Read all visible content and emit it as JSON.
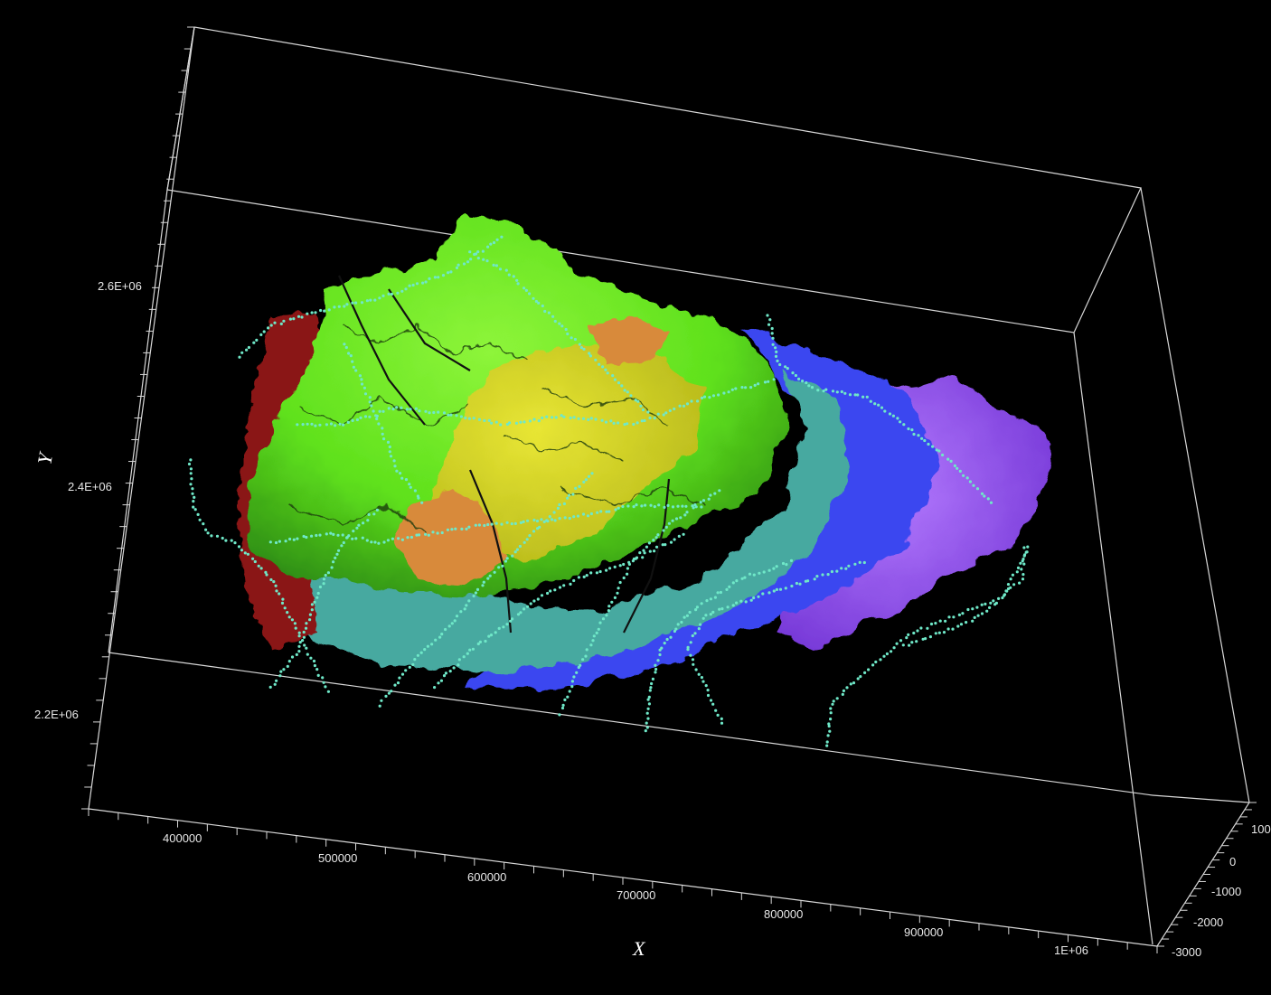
{
  "viewer": {
    "background": "#000000",
    "box_color": "#d8d8d8",
    "axes": {
      "x": {
        "title": "X",
        "ticks": [
          "400000",
          "500000",
          "600000",
          "700000",
          "800000",
          "900000",
          "1E+06"
        ]
      },
      "y": {
        "title": "Y",
        "ticks": [
          "2.2E+06",
          "2.4E+06",
          "2.6E+06"
        ]
      },
      "z": {
        "title": "",
        "ticks": [
          "100",
          "0",
          "-1000",
          "-2000",
          "-3000"
        ]
      }
    },
    "palette": {
      "bright_green": "#66ee22",
      "yellow": "#d6dc1e",
      "orange": "#d88a3a",
      "dark_red": "#8a1414",
      "teal": "#4bb3a6",
      "blue": "#3a4cff",
      "violet": "#9a4cf0",
      "well_dots": "#6fe8c8"
    }
  }
}
